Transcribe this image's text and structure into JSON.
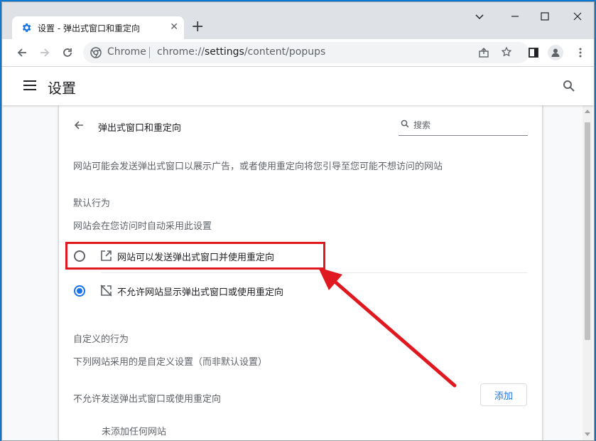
{
  "browser": {
    "tab_title": "设置 - 弹出式窗口和重定向",
    "omnibox_label": "Chrome",
    "url_scheme": "chrome://",
    "url_host": "settings",
    "url_path": "/content/popups"
  },
  "header": {
    "title": "设置"
  },
  "page": {
    "subpage_title": "弹出式窗口和重定向",
    "search_placeholder": "搜索",
    "description": "网站可能会发送弹出式窗口以展示广告，或者使用重定向将您引导至您可能不想访问的网站",
    "default_heading": "默认行为",
    "default_desc": "网站会在您访问时自动采用此设置",
    "options": [
      {
        "label": "网站可以发送弹出式窗口并使用重定向",
        "selected": false,
        "icon": "open-in-new-icon"
      },
      {
        "label": "不允许网站显示弹出式窗口或使用重定向",
        "selected": true,
        "icon": "popup-blocked-icon"
      }
    ],
    "custom_heading": "自定义的行为",
    "custom_desc": "下列网站采用的是自定义设置（而非默认设置）",
    "block_list_label": "不允许发送弹出式窗口或使用重定向",
    "add_button": "添加",
    "empty_label": "未添加任何网站"
  },
  "colors": {
    "accent": "#1a73e8",
    "annotation": "#e01820"
  }
}
